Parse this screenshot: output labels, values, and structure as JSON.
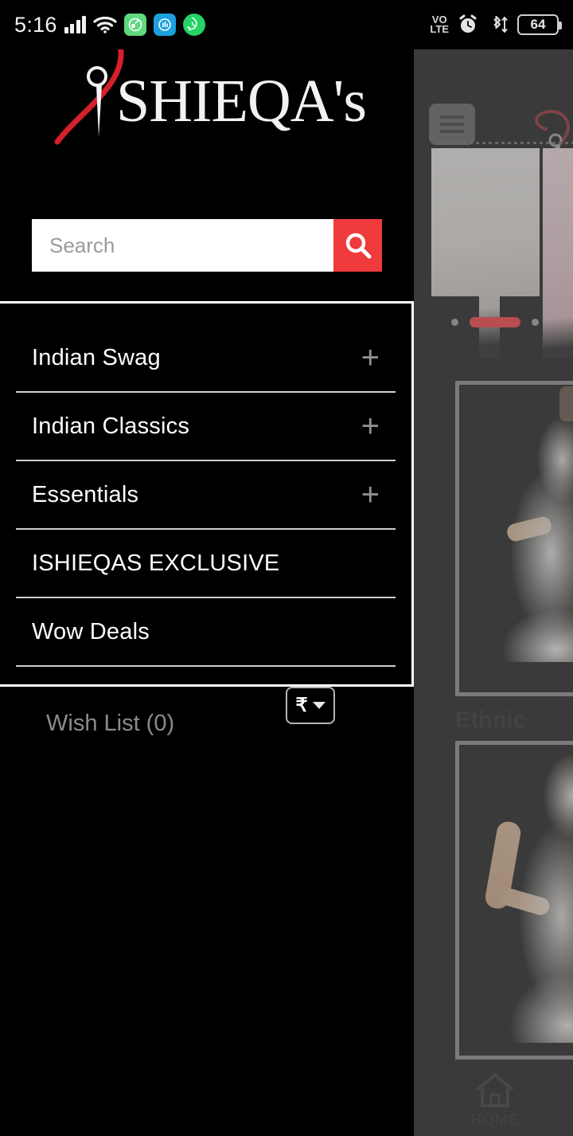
{
  "status_bar": {
    "time": "5:16",
    "signal_icon": "cellular-signal-icon",
    "wifi_icon": "wifi-icon",
    "notification_icons": [
      "green-app-icon",
      "blue-app-icon",
      "whatsapp-icon"
    ],
    "volte_line1": "VO",
    "volte_line2": "LTE",
    "alarm_icon": "alarm-clock-icon",
    "bluetooth_icon": "bluetooth-transfer-icon",
    "battery_level": "64"
  },
  "drawer": {
    "logo_text": "ISHIEQA's",
    "logo_accent_color": "#d4202a",
    "search": {
      "placeholder": "Search",
      "value": "",
      "button_icon": "search-icon",
      "button_color": "#ef3b3b"
    },
    "menu_items": [
      {
        "label": "Indian Swag",
        "expandable": true,
        "expand_icon": "plus-icon"
      },
      {
        "label": "Indian Classics",
        "expandable": true,
        "expand_icon": "plus-icon"
      },
      {
        "label": "Essentials",
        "expandable": true,
        "expand_icon": "plus-icon"
      },
      {
        "label": "ISHIEQAS EXCLUSIVE",
        "expandable": false,
        "expand_icon": ""
      },
      {
        "label": "Wow Deals",
        "expandable": false,
        "expand_icon": ""
      }
    ],
    "wish_list_label": "Wish List (0)",
    "currency": {
      "symbol": "₹",
      "dropdown_icon": "chevron-down-icon"
    }
  },
  "background_app": {
    "menu_button_icon": "hamburger-menu-icon",
    "logo_text": "ISHIEQA's",
    "carousel": {
      "dots_total": 3,
      "active_index": 1
    },
    "category_label": "Ethnic",
    "bottom_nav": [
      {
        "label": "HOME",
        "icon": "home-icon"
      }
    ]
  }
}
